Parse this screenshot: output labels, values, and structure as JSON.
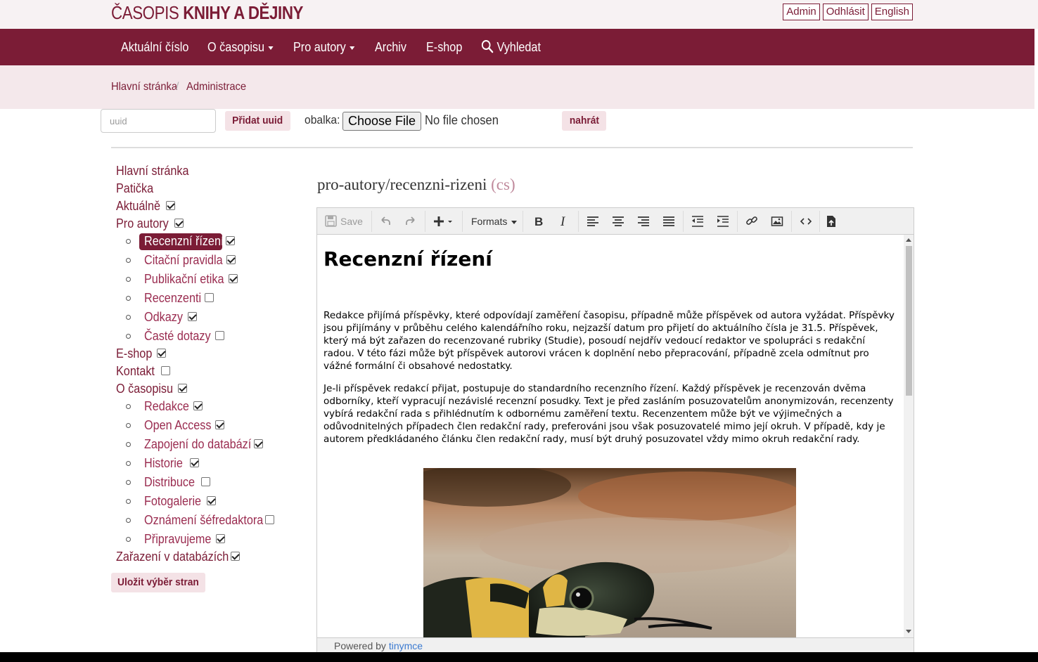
{
  "brand": {
    "light": "ČASOPIS ",
    "bold": "KNIHY A DĚJINY"
  },
  "top_links": [
    "Admin",
    "Odhlásit",
    "English"
  ],
  "nav": {
    "items": [
      {
        "label": "Aktuální číslo",
        "dropdown": false
      },
      {
        "label": "O časopisu",
        "dropdown": true
      },
      {
        "label": "Pro autory",
        "dropdown": true
      },
      {
        "label": "Archiv",
        "dropdown": false
      },
      {
        "label": "E-shop",
        "dropdown": false
      },
      {
        "label": "Vyhledat",
        "dropdown": false,
        "icon": "search-icon"
      }
    ]
  },
  "breadcrumb": [
    "Hlavní stránka",
    "Administrace"
  ],
  "admin_toolbar": {
    "uuid_placeholder": "uuid",
    "add_uuid_label": "Přidat uuid",
    "cover_label": "obalka:",
    "choose_file_label": "Choose File",
    "no_file_label": "No file chosen",
    "upload_label": "nahrát"
  },
  "sidebar": {
    "items": [
      {
        "label": "Hlavní stránka",
        "level": 0,
        "checkbox": null
      },
      {
        "label": "Patička",
        "level": 0,
        "checkbox": null
      },
      {
        "label": "Aktuálně",
        "level": 0,
        "checkbox": true
      },
      {
        "label": "Pro autory",
        "level": 0,
        "checkbox": true
      },
      {
        "label": "Recenzní řízení",
        "level": 1,
        "checkbox": true,
        "active": true
      },
      {
        "label": "Citační pravidla",
        "level": 1,
        "checkbox": true
      },
      {
        "label": "Publikační etika",
        "level": 1,
        "checkbox": true
      },
      {
        "label": "Recenzenti",
        "level": 1,
        "checkbox": false
      },
      {
        "label": "Odkazy",
        "level": 1,
        "checkbox": true
      },
      {
        "label": "Časté dotazy",
        "level": 1,
        "checkbox": false
      },
      {
        "label": "E-shop",
        "level": 0,
        "checkbox": true
      },
      {
        "label": "Kontakt",
        "level": 0,
        "checkbox": false
      },
      {
        "label": "O časopisu",
        "level": 0,
        "checkbox": true
      },
      {
        "label": "Redakce",
        "level": 1,
        "checkbox": true
      },
      {
        "label": "Open Access",
        "level": 1,
        "checkbox": true
      },
      {
        "label": "Zapojení do databází",
        "level": 1,
        "checkbox": true
      },
      {
        "label": "Historie",
        "level": 1,
        "checkbox": true
      },
      {
        "label": "Distribuce",
        "level": 1,
        "checkbox": false
      },
      {
        "label": "Fotogalerie",
        "level": 1,
        "checkbox": true
      },
      {
        "label": "Oznámení šéfredaktora",
        "level": 1,
        "checkbox": false
      },
      {
        "label": "Připravujeme",
        "level": 1,
        "checkbox": true
      },
      {
        "label": "Zařazení v databázích",
        "level": 0,
        "checkbox": true
      }
    ],
    "save_label": "Uložit výběr stran"
  },
  "main": {
    "path": "pro-autory/recenzni-rizeni",
    "lang": "(cs)"
  },
  "editor": {
    "toolbar": {
      "save_label": "Save",
      "formats_label": "Formats"
    },
    "heading": "Recenzní řízení",
    "paragraphs": [
      "Redakce přijímá příspěvky, které odpovídají zaměření časopisu, případně může příspěvek od autora vyžádat. Příspěvky jsou přijímány v průběhu celého kalendářního roku, nejzazší datum pro přijetí do aktuálního čísla je 31.5. Příspěvek, který má být zařazen do recenzované rubriky (Studie), posoudí nejdřív vedoucí redaktor ve spolupráci s redakční radou. V této fázi může být příspěvek autorovi vrácen k doplnění nebo přepracování, případně zcela odmítnut pro vážné formální či obsahové nedostatky.",
      "Je-li příspěvek redakcí přijat, postupuje do standardního recenzního řízení. Každý příspěvek je recenzován dvěma odborníky, kteří vypracují nezávislé recenzní posudky. Text je před zasláním posuzovatelům anonymizován, recenzenty vybírá redakční rada s přihlédnutím k odbornému zaměření textu. Recenzentem může být ve výjimečných a odůvodnitelných případech člen redakční rady, preferováni jsou však posuzovatelé mimo její okruh. V případě, kdy je autorem předkládaného článku člen redakční rady, musí být druhý posuzovatel vždy mimo okruh redakční rady."
    ],
    "powered_by": "Powered by ",
    "powered_link": "tinymce"
  },
  "colors": {
    "brand": "#7b1c36",
    "band": "#f4e8eb",
    "button_bg": "#f4e2e6"
  }
}
